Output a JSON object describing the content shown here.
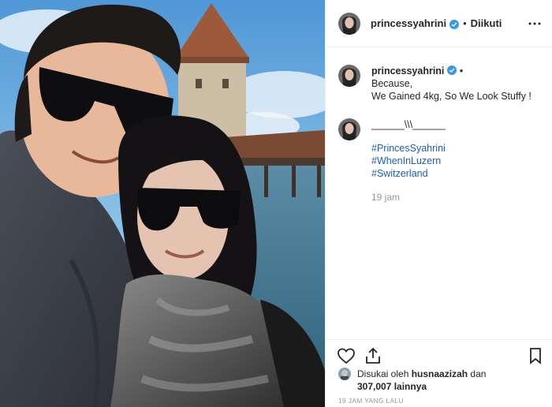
{
  "header": {
    "username": "princessyahrini",
    "separator": "•",
    "follow_status": "Diikuti"
  },
  "caption": {
    "username": "princessyahrini",
    "separator": "•",
    "line1": "Because,",
    "line2": "We Gained 4kg, So We Look Stuffy !"
  },
  "comment": {
    "text": "______\\\\\\______",
    "hashtags": [
      "#PrincesSyahrini",
      "#WhenInLuzern",
      "#Switzerland"
    ],
    "time": "19 jam"
  },
  "likes": {
    "prefix": "Disukai oleh",
    "user": "husnaazizah",
    "conj": "dan",
    "count": "307,007 lainnya"
  },
  "footer": {
    "time": "19 JAM YANG LALU"
  },
  "colors": {
    "hashtag": "#1a5fb4",
    "verified": "#3897f0",
    "muted": "#999999"
  }
}
